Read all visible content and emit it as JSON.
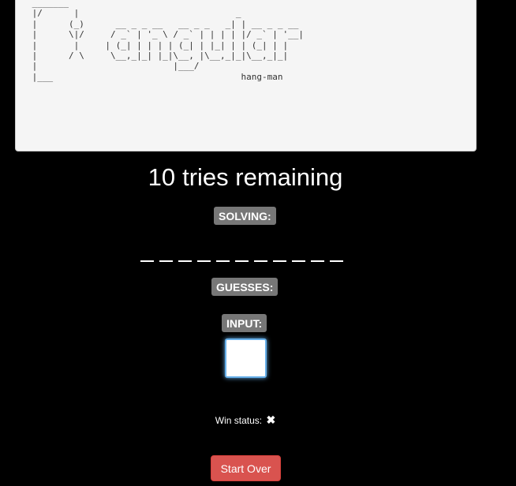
{
  "banner": {
    "ascii_art": " _______\n |/      |                              _\n |      (_)      __ _ _ __   __ _ _   _| | __ _ _ __\n |      \\|/     / _` | '_ \\ / _` | | | | |/ _` | '__|\n |       |     | (_| | | | | (_| | |_| | | (_| | |\n |      / \\     \\__,_|_| |_|\\__, |\\__,_|_|\\__,_|_|\n |                          |___/\n |___                                    hang-man"
  },
  "game": {
    "tries_count": "10",
    "tries_text": "tries remaining",
    "solving_label": "SOLVING:",
    "word_blanks": [
      "",
      "",
      "",
      "",
      "",
      "",
      "",
      "",
      "",
      "",
      ""
    ],
    "guesses_label": "GUESSES:",
    "guesses": "",
    "input_label": "INPUT:",
    "input_value": "",
    "win_status_label": "Win status:",
    "win_status_mark": "✖",
    "start_over_label": "Start Over"
  },
  "colors": {
    "background": "#000000",
    "label_bg": "#777777",
    "button_bg": "#d9534f",
    "input_focus": "#66afe9"
  }
}
